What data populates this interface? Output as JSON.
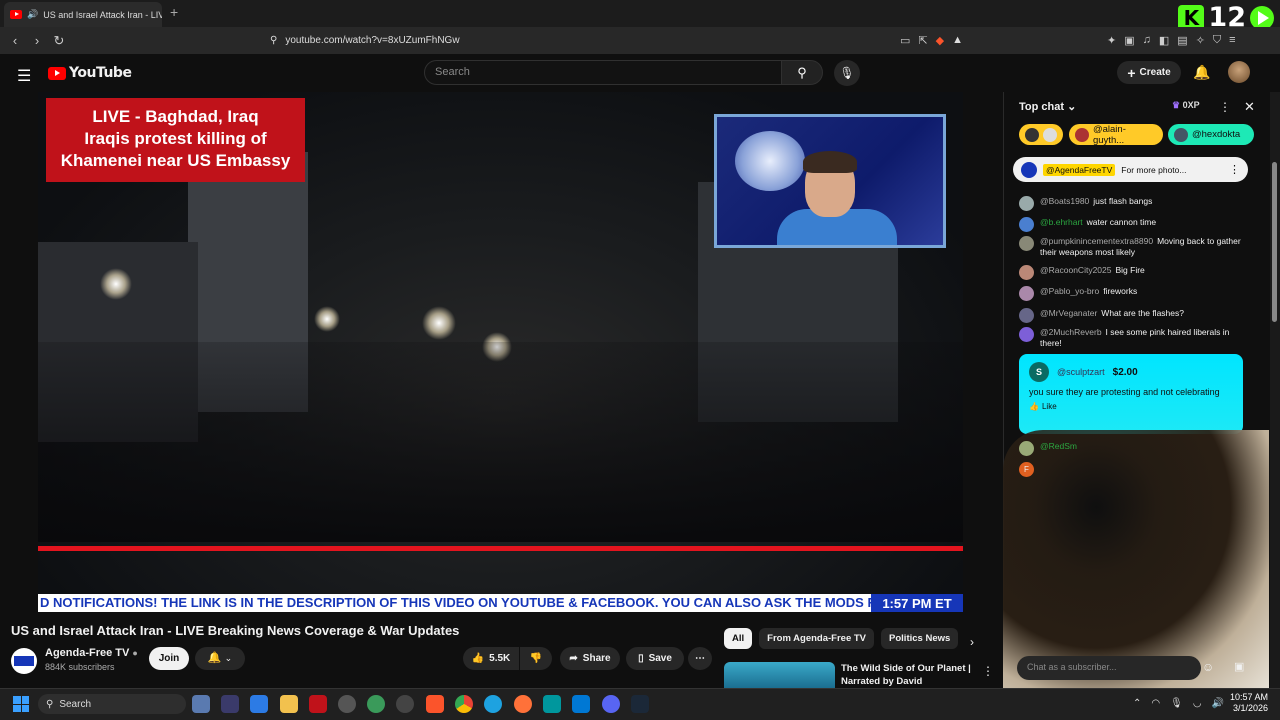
{
  "browser": {
    "tab_title": "US and Israel Attack Iran - LIVE",
    "tab_close": "✕",
    "new_tab": "+",
    "url": "youtube.com/watch?v=8xUZumFhNGw",
    "overlay_text": "12"
  },
  "header": {
    "logo_text": "YouTube",
    "search_placeholder": "Search",
    "create_label": "Create"
  },
  "video": {
    "overlay_title": [
      "LIVE - Baghdad, Iraq",
      "Iraqis protest killing of",
      "Khamenei near US Embassy"
    ],
    "ticker_text": "D NOTIFICATIONS! THE LINK IS IN THE DESCRIPTION OF THIS VIDEO ON YOUTUBE & FACEBOOK. YOU CAN ALSO ASK THE MODS FO",
    "ticker_time": "1:57 PM ET"
  },
  "details": {
    "title": "US and Israel Attack Iran - LIVE Breaking News Coverage & War Updates",
    "channel_name": "Agenda-Free TV",
    "subscribers": "884K subscribers",
    "join_label": "Join",
    "like_count": "5.5K",
    "share_label": "Share",
    "save_label": "Save"
  },
  "recommendations": {
    "chips": [
      "All",
      "From Agenda-Free TV",
      "Politics News"
    ],
    "video_title": "The Wild Side of Our Planet | Narrated by David Attenborou..."
  },
  "chat": {
    "header": "Top chat",
    "xp_label": "0XP",
    "tickers": [
      "@alain-guyth...",
      "@hexdokta"
    ],
    "pinned_author": "@AgendaFreeTV",
    "pinned_text": "For more photo...",
    "messages": [
      {
        "author": "@Boats1980",
        "text": "just flash bangs",
        "color": "#9aa"
      },
      {
        "author": "@b.ehrhart",
        "text": "water cannon time",
        "color": "#4a7fd0",
        "green": true
      },
      {
        "author": "@pumpkinincementextra8890",
        "text": "Moving back to gather their weapons most likely",
        "color": "#887"
      },
      {
        "author": "@RacoonCity2025",
        "text": "Big Fire",
        "color": "#b87"
      },
      {
        "author": "@Pablo_yo-bro",
        "text": "fireworks",
        "color": "#a8a"
      },
      {
        "author": "@MrVeganater",
        "text": "What are the flashes?",
        "color": "#668"
      },
      {
        "author": "@2MuchReverb",
        "text": "I see some pink haired liberals in there!",
        "color": "#7d5fd8"
      }
    ],
    "superchat": {
      "initial": "S",
      "author": "@sculptzart",
      "amount": "$2.00",
      "text": "you sure they are protesting and not celebrating",
      "like_label": "Like"
    },
    "partial_author": "@RedSm",
    "input_placeholder": "Chat as a subscriber..."
  },
  "taskbar": {
    "search_label": "Search",
    "time": "10:57 AM",
    "date": "3/1/2026"
  }
}
